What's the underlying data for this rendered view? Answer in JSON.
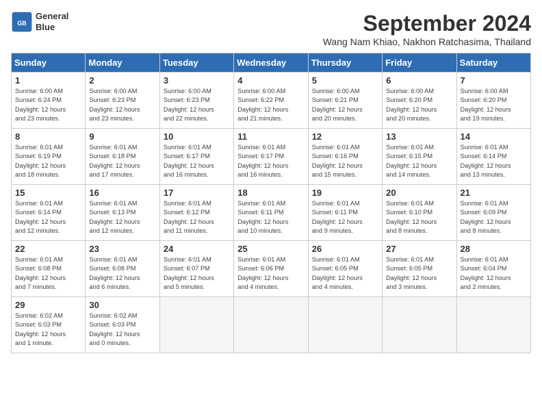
{
  "header": {
    "logo_line1": "General",
    "logo_line2": "Blue",
    "month_title": "September 2024",
    "location": "Wang Nam Khiao, Nakhon Ratchasima, Thailand"
  },
  "weekdays": [
    "Sunday",
    "Monday",
    "Tuesday",
    "Wednesday",
    "Thursday",
    "Friday",
    "Saturday"
  ],
  "weeks": [
    [
      {
        "day": "1",
        "info": "Sunrise: 6:00 AM\nSunset: 6:24 PM\nDaylight: 12 hours\nand 23 minutes."
      },
      {
        "day": "2",
        "info": "Sunrise: 6:00 AM\nSunset: 6:23 PM\nDaylight: 12 hours\nand 23 minutes."
      },
      {
        "day": "3",
        "info": "Sunrise: 6:00 AM\nSunset: 6:23 PM\nDaylight: 12 hours\nand 22 minutes."
      },
      {
        "day": "4",
        "info": "Sunrise: 6:00 AM\nSunset: 6:22 PM\nDaylight: 12 hours\nand 21 minutes."
      },
      {
        "day": "5",
        "info": "Sunrise: 6:00 AM\nSunset: 6:21 PM\nDaylight: 12 hours\nand 20 minutes."
      },
      {
        "day": "6",
        "info": "Sunrise: 6:00 AM\nSunset: 6:20 PM\nDaylight: 12 hours\nand 20 minutes."
      },
      {
        "day": "7",
        "info": "Sunrise: 6:00 AM\nSunset: 6:20 PM\nDaylight: 12 hours\nand 19 minutes."
      }
    ],
    [
      {
        "day": "8",
        "info": "Sunrise: 6:01 AM\nSunset: 6:19 PM\nDaylight: 12 hours\nand 18 minutes."
      },
      {
        "day": "9",
        "info": "Sunrise: 6:01 AM\nSunset: 6:18 PM\nDaylight: 12 hours\nand 17 minutes."
      },
      {
        "day": "10",
        "info": "Sunrise: 6:01 AM\nSunset: 6:17 PM\nDaylight: 12 hours\nand 16 minutes."
      },
      {
        "day": "11",
        "info": "Sunrise: 6:01 AM\nSunset: 6:17 PM\nDaylight: 12 hours\nand 16 minutes."
      },
      {
        "day": "12",
        "info": "Sunrise: 6:01 AM\nSunset: 6:16 PM\nDaylight: 12 hours\nand 15 minutes."
      },
      {
        "day": "13",
        "info": "Sunrise: 6:01 AM\nSunset: 6:15 PM\nDaylight: 12 hours\nand 14 minutes."
      },
      {
        "day": "14",
        "info": "Sunrise: 6:01 AM\nSunset: 6:14 PM\nDaylight: 12 hours\nand 13 minutes."
      }
    ],
    [
      {
        "day": "15",
        "info": "Sunrise: 6:01 AM\nSunset: 6:14 PM\nDaylight: 12 hours\nand 12 minutes."
      },
      {
        "day": "16",
        "info": "Sunrise: 6:01 AM\nSunset: 6:13 PM\nDaylight: 12 hours\nand 12 minutes."
      },
      {
        "day": "17",
        "info": "Sunrise: 6:01 AM\nSunset: 6:12 PM\nDaylight: 12 hours\nand 11 minutes."
      },
      {
        "day": "18",
        "info": "Sunrise: 6:01 AM\nSunset: 6:11 PM\nDaylight: 12 hours\nand 10 minutes."
      },
      {
        "day": "19",
        "info": "Sunrise: 6:01 AM\nSunset: 6:11 PM\nDaylight: 12 hours\nand 9 minutes."
      },
      {
        "day": "20",
        "info": "Sunrise: 6:01 AM\nSunset: 6:10 PM\nDaylight: 12 hours\nand 8 minutes."
      },
      {
        "day": "21",
        "info": "Sunrise: 6:01 AM\nSunset: 6:09 PM\nDaylight: 12 hours\nand 8 minutes."
      }
    ],
    [
      {
        "day": "22",
        "info": "Sunrise: 6:01 AM\nSunset: 6:08 PM\nDaylight: 12 hours\nand 7 minutes."
      },
      {
        "day": "23",
        "info": "Sunrise: 6:01 AM\nSunset: 6:08 PM\nDaylight: 12 hours\nand 6 minutes."
      },
      {
        "day": "24",
        "info": "Sunrise: 6:01 AM\nSunset: 6:07 PM\nDaylight: 12 hours\nand 5 minutes."
      },
      {
        "day": "25",
        "info": "Sunrise: 6:01 AM\nSunset: 6:06 PM\nDaylight: 12 hours\nand 4 minutes."
      },
      {
        "day": "26",
        "info": "Sunrise: 6:01 AM\nSunset: 6:05 PM\nDaylight: 12 hours\nand 4 minutes."
      },
      {
        "day": "27",
        "info": "Sunrise: 6:01 AM\nSunset: 6:05 PM\nDaylight: 12 hours\nand 3 minutes."
      },
      {
        "day": "28",
        "info": "Sunrise: 6:01 AM\nSunset: 6:04 PM\nDaylight: 12 hours\nand 2 minutes."
      }
    ],
    [
      {
        "day": "29",
        "info": "Sunrise: 6:02 AM\nSunset: 6:03 PM\nDaylight: 12 hours\nand 1 minute."
      },
      {
        "day": "30",
        "info": "Sunrise: 6:02 AM\nSunset: 6:03 PM\nDaylight: 12 hours\nand 0 minutes."
      },
      null,
      null,
      null,
      null,
      null
    ]
  ]
}
